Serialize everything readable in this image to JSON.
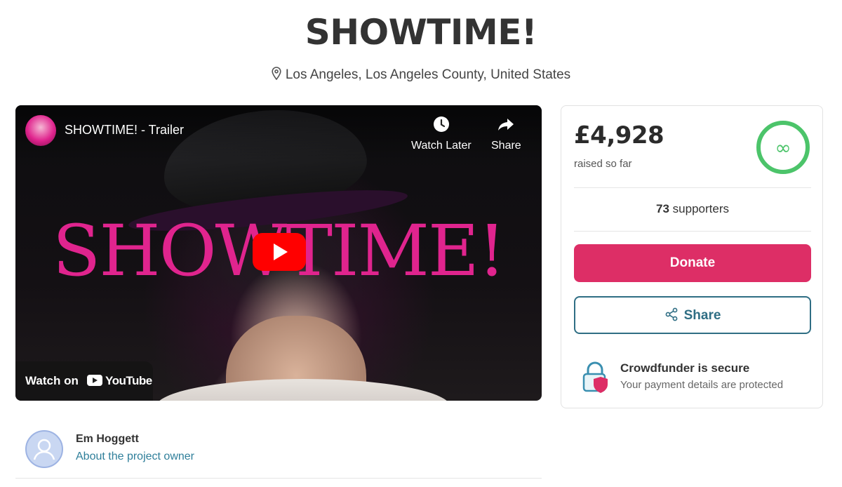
{
  "project": {
    "title": "SHOWTIME!",
    "location": "Los Angeles, Los Angeles County, United States"
  },
  "video": {
    "title": "SHOWTIME! - Trailer",
    "overlay_text": "SHOWTIME!",
    "watch_later_label": "Watch Later",
    "share_label": "Share",
    "watch_on_label": "Watch on",
    "youtube_label": "YouTube"
  },
  "funding": {
    "amount": "£4,928",
    "raised_label": "raised so far",
    "supporters_count": "73",
    "supporters_label": "supporters",
    "donate_label": "Donate",
    "share_label": "Share",
    "secure_title": "Crowdfunder is secure",
    "secure_subtitle": "Your payment details are protected",
    "ring_symbol": "∞"
  },
  "owner": {
    "name": "Em Hoggett",
    "link_label": "About the project owner"
  },
  "colors": {
    "donate": "#dd2e66",
    "share_border": "#2f6e84",
    "ring": "#4cc46a",
    "overlay_text": "#e0248e",
    "youtube_red": "#ff0000"
  }
}
